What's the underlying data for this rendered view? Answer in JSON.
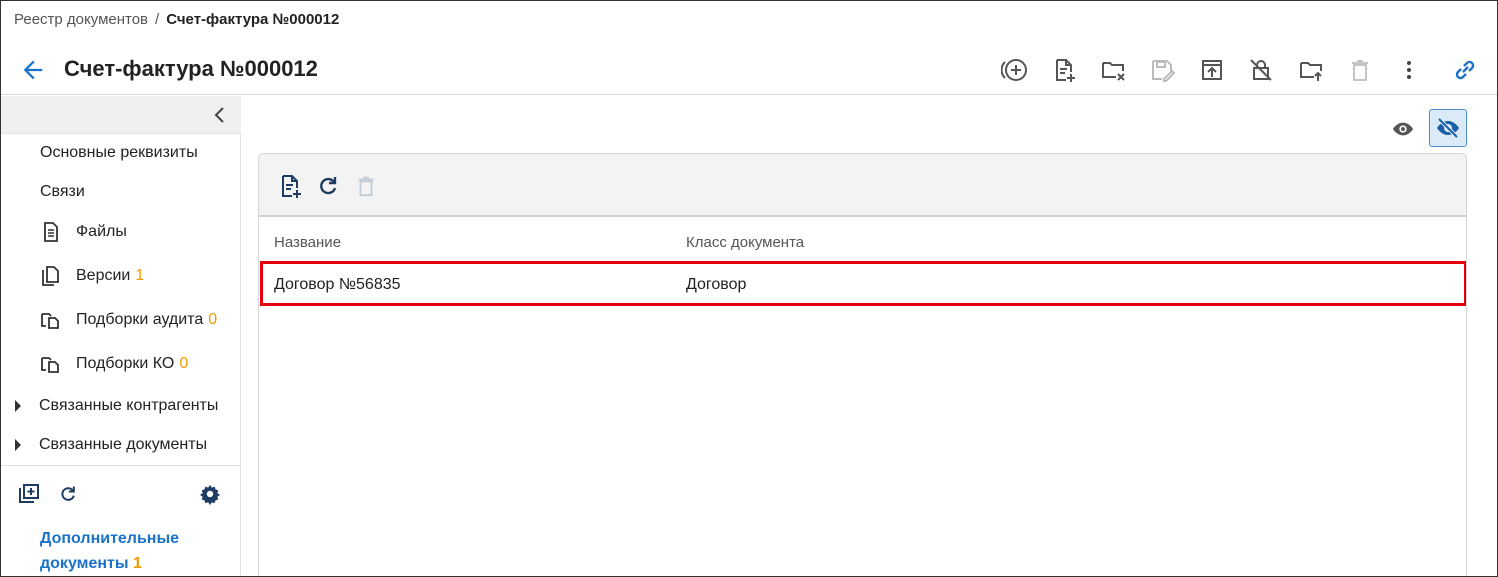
{
  "breadcrumb": {
    "parent": "Реестр документов",
    "separator": "/",
    "current": "Счет-фактура №000012"
  },
  "header": {
    "title": "Счет-фактура №000012",
    "toolbar_icons": [
      "add-circle-icon",
      "file-add-icon",
      "folder-remove-icon",
      "save-disabled-icon",
      "upload-box-icon",
      "lock-off-icon",
      "folder-upload-icon",
      "trash-disabled-icon",
      "more-vertical-icon",
      "link-icon"
    ]
  },
  "sidebar": {
    "items": [
      {
        "label": "Основные реквизиты"
      },
      {
        "label": "Связи"
      },
      {
        "label": "Файлы"
      },
      {
        "label": "Версии",
        "count": "1"
      },
      {
        "label": "Подборки аудита",
        "count": "0"
      },
      {
        "label": "Подборки КО",
        "count": "0"
      },
      {
        "label": "Связанные контрагенты"
      },
      {
        "label": "Связанные документы"
      }
    ],
    "additional": {
      "label_line1": "Дополнительные",
      "label_line2": "документы",
      "count": "1"
    }
  },
  "table": {
    "columns": [
      "Название",
      "Класс документа"
    ],
    "rows": [
      {
        "name": "Договор №56835",
        "class": "Договор"
      }
    ]
  },
  "colors": {
    "accent": "#1a73c8",
    "icon_dark": "#1f3d63",
    "count": "#f29b00",
    "highlight": "#e2000f"
  }
}
